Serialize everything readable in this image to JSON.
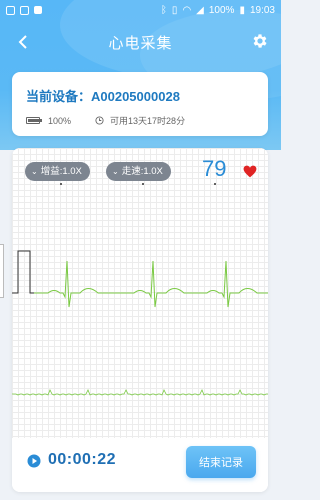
{
  "status_bar": {
    "battery_percent": "100%",
    "time": "19:03"
  },
  "header": {
    "title": "心电采集",
    "back_icon": "chevron-left-icon",
    "settings_icon": "gear-icon"
  },
  "device": {
    "label": "当前设备：A00205000028",
    "battery": "100%",
    "battery_level": 1.0,
    "remaining": "可用13天17时28分"
  },
  "monitor": {
    "gain_label": "增益:1.0X",
    "speed_label": "走速:1.0X",
    "heart_rate": "79",
    "heart_color": "#e02424",
    "trace_color": "#7ac943"
  },
  "recording": {
    "elapsed": "00:00:22",
    "stop_label": "结束记录"
  },
  "colors": {
    "header": "#57b7f7",
    "accent": "#1f7ac0",
    "button": "#4aa8ee"
  }
}
